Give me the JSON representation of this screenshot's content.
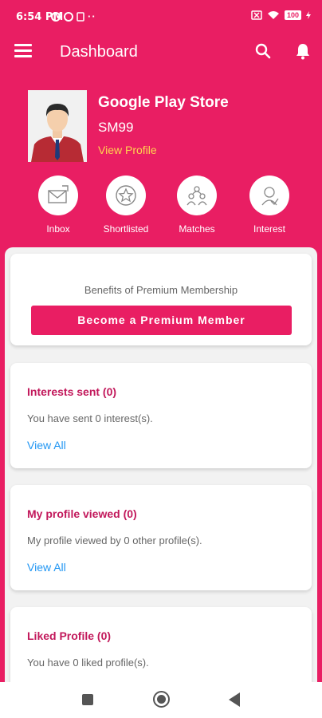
{
  "status_bar": {
    "time": "6:54 PM",
    "extra_dots": "··",
    "battery": "100",
    "icons": [
      "notification-icon",
      "app-icon",
      "sim-icon",
      "wifi-icon",
      "battery-icon",
      "charging-icon"
    ]
  },
  "app_bar": {
    "title": "Dashboard",
    "icons": [
      "menu-icon",
      "search-icon",
      "bell-icon"
    ]
  },
  "profile": {
    "name": "Google Play Store",
    "id": "SM99",
    "link": "View Profile"
  },
  "quick_actions": [
    {
      "label": "Inbox",
      "icon": "mail-icon"
    },
    {
      "label": "Shortlisted",
      "icon": "star-icon"
    },
    {
      "label": "Matches",
      "icon": "people-icon"
    },
    {
      "label": "Interest",
      "icon": "interest-icon"
    }
  ],
  "premium": {
    "text": "Benefits of Premium Membership",
    "button": "Become a Premium Member"
  },
  "cards": [
    {
      "title": "Interests sent (0)",
      "body": "You have sent 0 interest(s).",
      "link": "View All"
    },
    {
      "title": "My profile viewed (0)",
      "body": "My profile viewed by 0 other profile(s).",
      "link": "View All"
    },
    {
      "title": "Liked Profile (0)",
      "body": "You have 0 liked profile(s)."
    }
  ],
  "colors": {
    "primary": "#e91e63",
    "title_text": "#c2185b",
    "link": "#2196f3",
    "profile_link": "#ffd54f"
  }
}
